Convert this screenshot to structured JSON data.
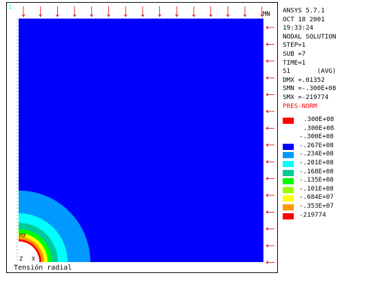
{
  "window_number": "1",
  "plot": {
    "mn_label": "MN",
    "mx_label": "MX",
    "axis_x": "X",
    "axis_y": "Y",
    "axis_z": "Z",
    "caption": "Tensión radial"
  },
  "info": {
    "lines": [
      "ANSYS 5.7.1",
      "OCT 18 2001",
      "19:33:24",
      "NODAL SOLUTION",
      "STEP=1",
      "SUB =7",
      "TIME=1",
      "S1       (AVG)",
      "DMX =.01352",
      "SMN =-.300E+08",
      "SMX =-219774",
      "PRES-NORM"
    ],
    "pres_norm_color": "#ff0000"
  },
  "legend": {
    "header_values": [
      ".300E+08",
      ".300E+08"
    ],
    "header_swatch_color": "#ff0000",
    "entries": [
      {
        "label": "-.300E+08",
        "color": null
      },
      {
        "label": "-.267E+08",
        "color": "#0000ff"
      },
      {
        "label": "-.234E+08",
        "color": "#0099ff"
      },
      {
        "label": "-.201E+08",
        "color": "#00ffff"
      },
      {
        "label": "-.168E+08",
        "color": "#00cc99"
      },
      {
        "label": "-.135E+08",
        "color": "#00ff00"
      },
      {
        "label": "-.101E+08",
        "color": "#99ff00"
      },
      {
        "label": "-.684E+07",
        "color": "#ffff00"
      },
      {
        "label": "-.353E+07",
        "color": "#ff9900"
      },
      {
        "label": "-219774",
        "color": "#ff0000"
      }
    ]
  },
  "colors": {
    "background": "#ffffff",
    "field": "#0000ff",
    "load_arrows": "#cc0000",
    "contour_bands": [
      "#0099ff",
      "#00ffff",
      "#00cc99",
      "#00ff00",
      "#ffff00",
      "#ff9900",
      "#ff0000"
    ]
  }
}
